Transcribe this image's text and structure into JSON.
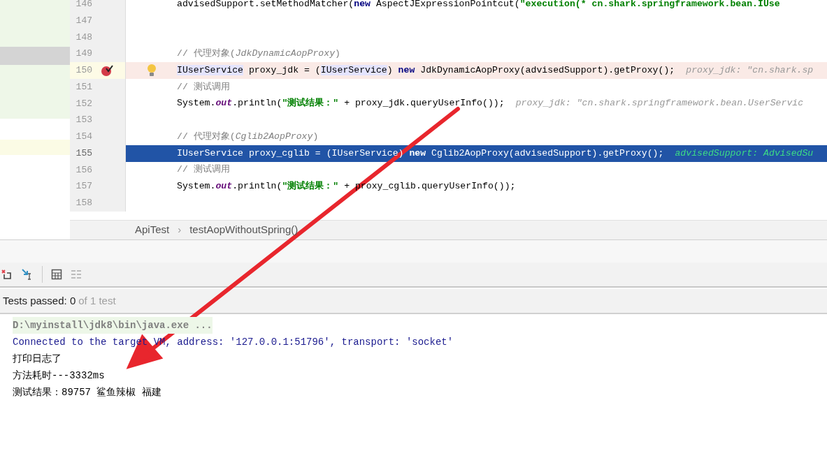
{
  "editor": {
    "lines": [
      {
        "number": "146",
        "selected": false,
        "breakpoint": false,
        "bulb": false,
        "segments": [
          {
            "kind": "plain",
            "text": "advisedSupport.setMethodMatcher("
          },
          {
            "kind": "keyword",
            "text": "new"
          },
          {
            "kind": "plain",
            "text": " AspectJExpressionPointcut("
          },
          {
            "kind": "string",
            "text": "\"execution(* cn.shark.springframework.bean.IUse"
          }
        ]
      },
      {
        "number": "147",
        "selected": false,
        "breakpoint": false,
        "bulb": false
      },
      {
        "number": "148",
        "selected": false,
        "breakpoint": false,
        "bulb": false
      },
      {
        "number": "149",
        "selected": false,
        "breakpoint": false,
        "bulb": false,
        "segments": [
          {
            "kind": "comment",
            "text": "// 代理对象("
          },
          {
            "kind": "comment-italic",
            "text": "JdkDynamicAopProxy"
          },
          {
            "kind": "comment",
            "text": ")"
          }
        ]
      },
      {
        "number": "150",
        "selected": false,
        "breakpoint": true,
        "bulb": true,
        "segments": [
          {
            "kind": "usage",
            "text": "IUserService"
          },
          {
            "kind": "plain",
            "text": " proxy_jdk = ("
          },
          {
            "kind": "usage",
            "text": "IUserService"
          },
          {
            "kind": "plain",
            "text": ") "
          },
          {
            "kind": "keyword",
            "text": "new"
          },
          {
            "kind": "plain",
            "text": " JdkDynamicAopProxy(advisedSupport).getProxy();"
          },
          {
            "kind": "hint",
            "text": "proxy_jdk: \"cn.shark.sp"
          }
        ]
      },
      {
        "number": "151",
        "selected": false,
        "breakpoint": false,
        "bulb": false,
        "segments": [
          {
            "kind": "comment",
            "text": "// 测试调用"
          }
        ]
      },
      {
        "number": "152",
        "selected": false,
        "breakpoint": false,
        "bulb": false,
        "segments": [
          {
            "kind": "plain",
            "text": "System."
          },
          {
            "kind": "field",
            "text": "out"
          },
          {
            "kind": "plain",
            "text": ".println("
          },
          {
            "kind": "string",
            "text": "\"测试结果：\""
          },
          {
            "kind": "plain",
            "text": " + proxy_jdk.queryUserInfo());"
          },
          {
            "kind": "hint",
            "text": "proxy_jdk: \"cn.shark.springframework.bean.UserServic"
          }
        ]
      },
      {
        "number": "153",
        "selected": false,
        "breakpoint": false,
        "bulb": false
      },
      {
        "number": "154",
        "selected": false,
        "breakpoint": false,
        "bulb": false,
        "segments": [
          {
            "kind": "comment",
            "text": "// 代理对象("
          },
          {
            "kind": "comment-italic",
            "text": "Cglib2AopProxy"
          },
          {
            "kind": "comment",
            "text": ")"
          }
        ]
      },
      {
        "number": "155",
        "selected": true,
        "breakpoint": false,
        "bulb": false,
        "segments": [
          {
            "kind": "plain",
            "text": "IUserService proxy_cglib = (IUserService) "
          },
          {
            "kind": "keyword",
            "text": "new"
          },
          {
            "kind": "plain",
            "text": " Cglib2AopProxy(advisedSupport).getProxy();"
          },
          {
            "kind": "hint",
            "text": "advisedSupport: AdvisedSu"
          }
        ]
      },
      {
        "number": "156",
        "selected": false,
        "breakpoint": false,
        "bulb": false,
        "segments": [
          {
            "kind": "comment",
            "text": "// 测试调用"
          }
        ]
      },
      {
        "number": "157",
        "selected": false,
        "breakpoint": false,
        "bulb": false,
        "segments": [
          {
            "kind": "plain",
            "text": "System."
          },
          {
            "kind": "field",
            "text": "out"
          },
          {
            "kind": "plain",
            "text": ".println("
          },
          {
            "kind": "string",
            "text": "\"测试结果：\""
          },
          {
            "kind": "plain",
            "text": " + proxy_cglib.queryUserInfo());"
          }
        ]
      },
      {
        "number": "158",
        "selected": false,
        "breakpoint": false,
        "bulb": false
      }
    ]
  },
  "breadcrumb": [
    "ApiTest",
    "testAopWithoutSpring()"
  ],
  "breadcrumb_separator": "›",
  "test_status": {
    "label": "Tests passed: 0",
    "detail": "of 1 test"
  },
  "console": [
    {
      "kind": "command",
      "text": "D:\\myinstall\\jdk8\\bin\\java.exe ..."
    },
    {
      "kind": "system",
      "text": "Connected to the target VM, address: '127.0.0.1:51796', transport: 'socket'"
    },
    {
      "kind": "output",
      "text": "打印日志了"
    },
    {
      "kind": "output",
      "text": "方法耗时---3332ms"
    },
    {
      "kind": "output",
      "text": "测试结果：89757 鲨鱼辣椒 福建"
    }
  ]
}
